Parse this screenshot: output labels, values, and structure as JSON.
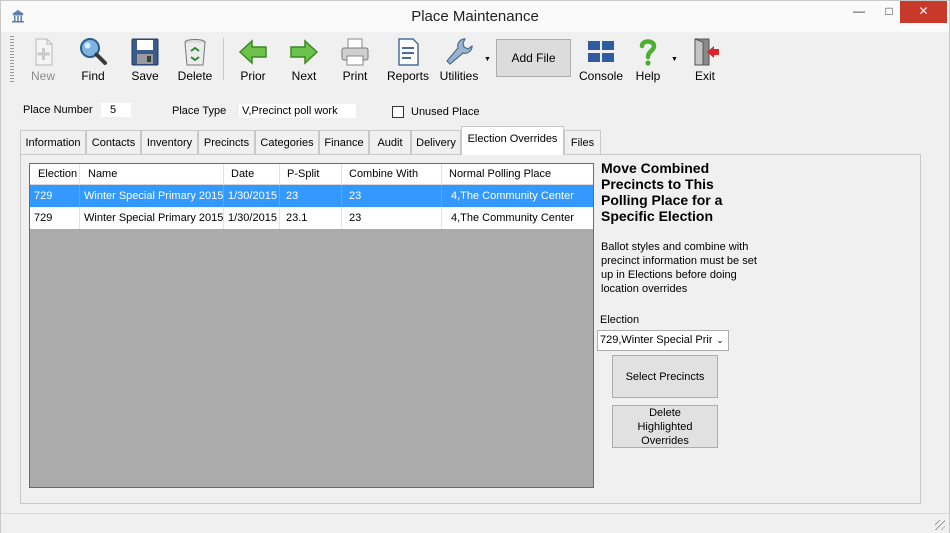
{
  "window": {
    "title": "Place Maintenance",
    "minimize_glyph": "—",
    "maximize_glyph": "□",
    "close_glyph": "✕"
  },
  "toolbar": {
    "new_label": "New",
    "find_label": "Find",
    "save_label": "Save",
    "delete_label": "Delete",
    "prior_label": "Prior",
    "next_label": "Next",
    "print_label": "Print",
    "reports_label": "Reports",
    "utilities_label": "Utilities",
    "add_file_label": "Add File",
    "console_label": "Console",
    "help_label": "Help",
    "exit_label": "Exit",
    "dropdown_glyph": "▼"
  },
  "form": {
    "place_number_label": "Place Number",
    "place_number_value": "5",
    "place_type_label": "Place Type",
    "place_type_value": "V,Precinct poll work",
    "unused_place_label": "Unused Place"
  },
  "tabs": [
    {
      "label": "Information"
    },
    {
      "label": "Contacts"
    },
    {
      "label": "Inventory"
    },
    {
      "label": "Precincts"
    },
    {
      "label": "Categories"
    },
    {
      "label": "Finance"
    },
    {
      "label": "Audit"
    },
    {
      "label": "Delivery"
    },
    {
      "label": "Election Overrides"
    },
    {
      "label": "Files"
    }
  ],
  "grid": {
    "columns": [
      "Election",
      "Name",
      "Date",
      "P-Split",
      "Combine With",
      "Normal Polling Place"
    ],
    "rows": [
      [
        "729",
        "Winter Special Primary 2015",
        "1/30/2015",
        "23",
        "23",
        "4,The Community Center"
      ],
      [
        "729",
        "Winter Special Primary 2015",
        "1/30/2015",
        "23.1",
        "23",
        "4,The Community Center"
      ]
    ]
  },
  "side": {
    "heading": "Move Combined Precincts to This Polling Place for a Specific Election",
    "note": "Ballot styles and combine with precinct information must be set up in Elections before doing location overrides",
    "election_label": "Election",
    "election_value": "729,Winter Special Prir",
    "select_arrow": "⌄",
    "select_precincts_label": "Select Precincts",
    "delete_overrides_label": "Delete Highlighted Overrides"
  },
  "colors": {
    "selection": "#3399ff",
    "grid_background": "#ababab",
    "close_button": "#c7392b"
  }
}
